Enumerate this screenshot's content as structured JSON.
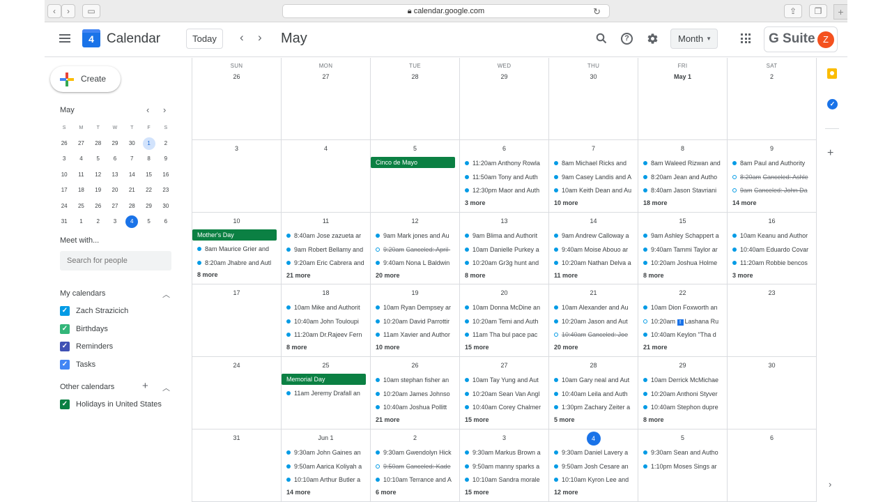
{
  "browser": {
    "url": "calendar.google.com"
  },
  "header": {
    "logo_day": "4",
    "app_title": "Calendar",
    "today_label": "Today",
    "month_title": "May",
    "view_label": "Month",
    "brand": "G Suite",
    "avatar_letter": "Z"
  },
  "sidebar": {
    "create_label": "Create",
    "mini_month": "May",
    "mini_dow": [
      "S",
      "M",
      "T",
      "W",
      "T",
      "F",
      "S"
    ],
    "mini_weeks": [
      [
        {
          "d": "26"
        },
        {
          "d": "27"
        },
        {
          "d": "28"
        },
        {
          "d": "29"
        },
        {
          "d": "30"
        },
        {
          "d": "1",
          "sel": true
        },
        {
          "d": "2"
        }
      ],
      [
        {
          "d": "3"
        },
        {
          "d": "4"
        },
        {
          "d": "5"
        },
        {
          "d": "6"
        },
        {
          "d": "7"
        },
        {
          "d": "8"
        },
        {
          "d": "9"
        }
      ],
      [
        {
          "d": "10"
        },
        {
          "d": "11"
        },
        {
          "d": "12"
        },
        {
          "d": "13"
        },
        {
          "d": "14"
        },
        {
          "d": "15"
        },
        {
          "d": "16"
        }
      ],
      [
        {
          "d": "17"
        },
        {
          "d": "18"
        },
        {
          "d": "19"
        },
        {
          "d": "20"
        },
        {
          "d": "21"
        },
        {
          "d": "22"
        },
        {
          "d": "23"
        }
      ],
      [
        {
          "d": "24"
        },
        {
          "d": "25"
        },
        {
          "d": "26"
        },
        {
          "d": "27"
        },
        {
          "d": "28"
        },
        {
          "d": "29"
        },
        {
          "d": "30"
        }
      ],
      [
        {
          "d": "31"
        },
        {
          "d": "1"
        },
        {
          "d": "2"
        },
        {
          "d": "3"
        },
        {
          "d": "4",
          "today": true
        },
        {
          "d": "5"
        },
        {
          "d": "6"
        }
      ]
    ],
    "meet_title": "Meet with...",
    "people_placeholder": "Search for people",
    "my_calendars_title": "My calendars",
    "my_calendars": [
      {
        "label": "Zach Strazicich",
        "color": "#039be5"
      },
      {
        "label": "Birthdays",
        "color": "#33b679"
      },
      {
        "label": "Reminders",
        "color": "#3f51b5"
      },
      {
        "label": "Tasks",
        "color": "#4285f4"
      }
    ],
    "other_calendars_title": "Other calendars",
    "other_calendars": [
      {
        "label": "Holidays in United States",
        "color": "#0b8043"
      }
    ]
  },
  "month": {
    "weekdays": [
      "SUN",
      "MON",
      "TUE",
      "WED",
      "THU",
      "FRI",
      "SAT"
    ],
    "weeks": [
      [
        {
          "day": "26"
        },
        {
          "day": "27"
        },
        {
          "day": "28"
        },
        {
          "day": "29"
        },
        {
          "day": "30"
        },
        {
          "day": "May 1",
          "bold": true
        },
        {
          "day": "2"
        }
      ],
      [
        {
          "day": "3"
        },
        {
          "day": "4"
        },
        {
          "day": "5",
          "allday": "Cinco de Mayo"
        },
        {
          "day": "6",
          "events": [
            {
              "time": "11:20am",
              "title": "Anthony Rowla"
            },
            {
              "time": "11:50am",
              "title": "Tony and Auth"
            },
            {
              "time": "12:30pm",
              "title": "Maor and Auth"
            }
          ],
          "more": "3 more"
        },
        {
          "day": "7",
          "events": [
            {
              "time": "8am",
              "title": "Michael Ricks and"
            },
            {
              "time": "9am",
              "title": "Casey Landis and A"
            },
            {
              "time": "10am",
              "title": "Keith Dean and Au"
            }
          ],
          "more": "10 more"
        },
        {
          "day": "8",
          "events": [
            {
              "time": "8am",
              "title": "Waleed Rizwan and"
            },
            {
              "time": "8:20am",
              "title": "Jean and Autho"
            },
            {
              "time": "8:40am",
              "title": "Jason Stavriani"
            }
          ],
          "more": "18 more"
        },
        {
          "day": "9",
          "events": [
            {
              "time": "8am",
              "title": "Paul and Authority"
            },
            {
              "time": "8:20am",
              "title": "Canceled: Ashle",
              "canceled": true
            },
            {
              "time": "9am",
              "title": "Canceled: John Da",
              "canceled": true
            }
          ],
          "more": "14 more"
        }
      ],
      [
        {
          "day": "10",
          "allday": "Mother's Day",
          "events": [
            {
              "time": "8am",
              "title": "Maurice Grier and"
            },
            {
              "time": "8:20am",
              "title": "Jhabre and Autl"
            }
          ],
          "more": "8 more"
        },
        {
          "day": "11",
          "events": [
            {
              "time": "8:40am",
              "title": "Jose zazueta ar"
            },
            {
              "time": "9am",
              "title": "Robert Bellamy and"
            },
            {
              "time": "9:20am",
              "title": "Eric Cabrera and"
            }
          ],
          "more": "21 more"
        },
        {
          "day": "12",
          "events": [
            {
              "time": "9am",
              "title": "Mark jones and Au"
            },
            {
              "time": "9:20am",
              "title": "Canceled: April-",
              "canceled": true
            },
            {
              "time": "9:40am",
              "title": "Nona L Baldwin"
            }
          ],
          "more": "20 more"
        },
        {
          "day": "13",
          "events": [
            {
              "time": "9am",
              "title": "Blima and Authorit"
            },
            {
              "time": "10am",
              "title": "Danielle Purkey a"
            },
            {
              "time": "10:20am",
              "title": "Gr3g hunt and"
            }
          ],
          "more": "8 more"
        },
        {
          "day": "14",
          "events": [
            {
              "time": "9am",
              "title": "Andrew Calloway a"
            },
            {
              "time": "9:40am",
              "title": "Moise Abouo ar"
            },
            {
              "time": "10:20am",
              "title": "Nathan Delva a"
            }
          ],
          "more": "11 more"
        },
        {
          "day": "15",
          "events": [
            {
              "time": "9am",
              "title": "Ashley Schappert a"
            },
            {
              "time": "9:40am",
              "title": "Tammi Taylor ar"
            },
            {
              "time": "10:20am",
              "title": "Joshua Holme"
            }
          ],
          "more": "8 more"
        },
        {
          "day": "16",
          "events": [
            {
              "time": "10am",
              "title": "Keanu and Author"
            },
            {
              "time": "10:40am",
              "title": "Eduardo Covar"
            },
            {
              "time": "11:20am",
              "title": "Robbie bencos"
            }
          ],
          "more": "3 more"
        }
      ],
      [
        {
          "day": "17"
        },
        {
          "day": "18",
          "events": [
            {
              "time": "10am",
              "title": "Mike and Authorit"
            },
            {
              "time": "10:40am",
              "title": "John Touloupi"
            },
            {
              "time": "11:20am",
              "title": "Dr.Rajeev Fern"
            }
          ],
          "more": "8 more"
        },
        {
          "day": "19",
          "events": [
            {
              "time": "10am",
              "title": "Ryan Dempsey ar"
            },
            {
              "time": "10:20am",
              "title": "David Parrottir"
            },
            {
              "time": "11am",
              "title": "Xavier and Author"
            }
          ],
          "more": "10 more"
        },
        {
          "day": "20",
          "events": [
            {
              "time": "10am",
              "title": "Donna McDine an"
            },
            {
              "time": "10:20am",
              "title": "Temi and Auth"
            },
            {
              "time": "11am",
              "title": "Tha bul pace pac"
            }
          ],
          "more": "15 more"
        },
        {
          "day": "21",
          "events": [
            {
              "time": "10am",
              "title": "Alexander and Au"
            },
            {
              "time": "10:20am",
              "title": "Jason and Aut"
            },
            {
              "time": "10:40am",
              "title": "Canceled: Joe",
              "canceled": true
            }
          ],
          "more": "20 more"
        },
        {
          "day": "22",
          "events": [
            {
              "time": "10am",
              "title": "Dion Foxworth an"
            },
            {
              "time": "10:20am",
              "title": "Lashana Ru",
              "badge": "!",
              "hollow": true
            },
            {
              "time": "10:40am",
              "title": "Keylon \"Tha d"
            }
          ],
          "more": "21 more"
        },
        {
          "day": "23"
        }
      ],
      [
        {
          "day": "24"
        },
        {
          "day": "25",
          "allday": "Memorial Day",
          "events": [
            {
              "time": "11am",
              "title": "Jeremy Drafall an"
            }
          ]
        },
        {
          "day": "26",
          "events": [
            {
              "time": "10am",
              "title": "stephan fisher an"
            },
            {
              "time": "10:20am",
              "title": "James Johnso"
            },
            {
              "time": "10:40am",
              "title": "Joshua Pollitt"
            }
          ],
          "more": "21 more"
        },
        {
          "day": "27",
          "events": [
            {
              "time": "10am",
              "title": "Tay Yung and Aut"
            },
            {
              "time": "10:20am",
              "title": "Sean Van Angl"
            },
            {
              "time": "10:40am",
              "title": "Corey Chalmer"
            }
          ],
          "more": "15 more"
        },
        {
          "day": "28",
          "events": [
            {
              "time": "10am",
              "title": "Gary neal and Aut"
            },
            {
              "time": "10:40am",
              "title": "Leila and Auth"
            },
            {
              "time": "1:30pm",
              "title": "Zachary Zeiter a"
            }
          ],
          "more": "5 more"
        },
        {
          "day": "29",
          "events": [
            {
              "time": "10am",
              "title": "Derrick McMichae"
            },
            {
              "time": "10:20am",
              "title": "Anthoni Styver"
            },
            {
              "time": "10:40am",
              "title": "Stephon dupre"
            }
          ],
          "more": "8 more"
        },
        {
          "day": "30"
        }
      ],
      [
        {
          "day": "31"
        },
        {
          "day": "Jun 1",
          "events": [
            {
              "time": "9:30am",
              "title": "John Gaines an"
            },
            {
              "time": "9:50am",
              "title": "Aarica Koliyah a"
            },
            {
              "time": "10:10am",
              "title": "Arthur Butler a"
            }
          ],
          "more": "14 more"
        },
        {
          "day": "2",
          "events": [
            {
              "time": "9:30am",
              "title": "Gwendolyn Hick"
            },
            {
              "time": "9:50am",
              "title": "Canceled: Kade",
              "canceled": true
            },
            {
              "time": "10:10am",
              "title": "Terrance and A"
            }
          ],
          "more": "6 more"
        },
        {
          "day": "3",
          "events": [
            {
              "time": "9:30am",
              "title": "Markus Brown a"
            },
            {
              "time": "9:50am",
              "title": "manny sparks a"
            },
            {
              "time": "10:10am",
              "title": "Sandra morale"
            }
          ],
          "more": "15 more"
        },
        {
          "day": "4",
          "today": true,
          "events": [
            {
              "time": "9:30am",
              "title": "Daniel Lavery a"
            },
            {
              "time": "9:50am",
              "title": "Josh Cesare an"
            },
            {
              "time": "10:10am",
              "title": "Kyron Lee and"
            }
          ],
          "more": "12 more"
        },
        {
          "day": "5",
          "events": [
            {
              "time": "9:30am",
              "title": "Sean and Autho"
            },
            {
              "time": "1:10pm",
              "title": "Moses Sings ar"
            }
          ]
        },
        {
          "day": "6"
        }
      ]
    ]
  }
}
